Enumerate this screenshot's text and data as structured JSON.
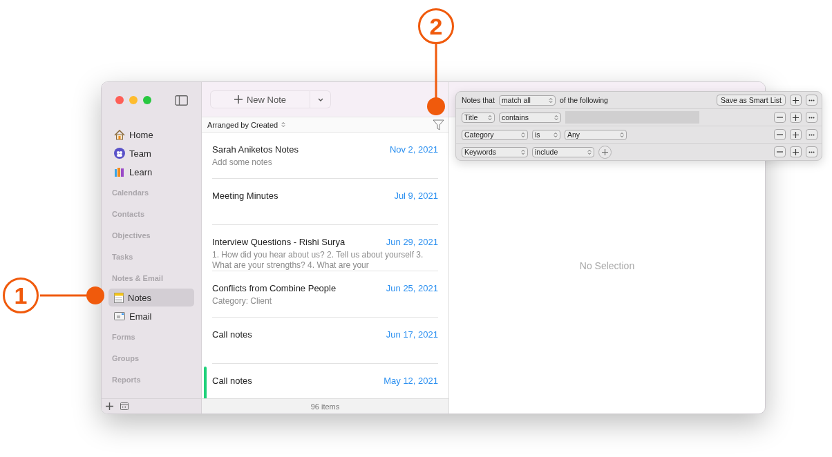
{
  "toolbar": {
    "new_note": "New Note"
  },
  "sidebar": {
    "items": [
      {
        "kind": "item",
        "label": "Home",
        "selected": false
      },
      {
        "kind": "item",
        "label": "Team",
        "selected": false
      },
      {
        "kind": "item",
        "label": "Learn",
        "selected": false
      },
      {
        "kind": "section",
        "label": "Calendars"
      },
      {
        "kind": "section",
        "label": "Contacts"
      },
      {
        "kind": "section",
        "label": "Objectives"
      },
      {
        "kind": "section",
        "label": "Tasks"
      },
      {
        "kind": "section",
        "label": "Notes & Email"
      },
      {
        "kind": "item",
        "label": "Notes",
        "selected": true
      },
      {
        "kind": "item",
        "label": "Email",
        "selected": false
      },
      {
        "kind": "section",
        "label": "Forms"
      },
      {
        "kind": "section",
        "label": "Groups"
      },
      {
        "kind": "section",
        "label": "Reports"
      }
    ]
  },
  "list": {
    "arrange": "Arranged by Created",
    "notes": [
      {
        "title": "Sarah Aniketos Notes",
        "date": "Nov 2, 2021",
        "preview": "Add some notes"
      },
      {
        "title": "Meeting Minutes",
        "date": "Jul 9, 2021"
      },
      {
        "title": "Interview Questions - Rishi Surya",
        "date": "Jun 29, 2021",
        "preview": "1. How did you hear about us? 2. Tell us about yourself 3. What are your strengths? 4. What are your"
      },
      {
        "title": "Conflicts from Combine People",
        "date": "Jun 25, 2021",
        "preview": "Category: Client"
      },
      {
        "title": "Call notes",
        "date": "Jun 17, 2021"
      },
      {
        "title": "Call notes",
        "date": "May 12, 2021",
        "color": "#1fd17a"
      }
    ],
    "count": "96 items"
  },
  "detail": {
    "empty": "No Selection"
  },
  "filter": {
    "prefix": "Notes that",
    "match": "match all",
    "suffix": "of the following",
    "save": "Save as Smart List",
    "rules": [
      {
        "field": "Title",
        "operator": "contains",
        "kind": "text"
      },
      {
        "field": "Category",
        "operator": "is",
        "value": "Any",
        "kind": "select"
      },
      {
        "field": "Keywords",
        "operator": "include",
        "kind": "add"
      }
    ]
  },
  "callouts": [
    {
      "label": "1"
    },
    {
      "label": "2"
    }
  ]
}
